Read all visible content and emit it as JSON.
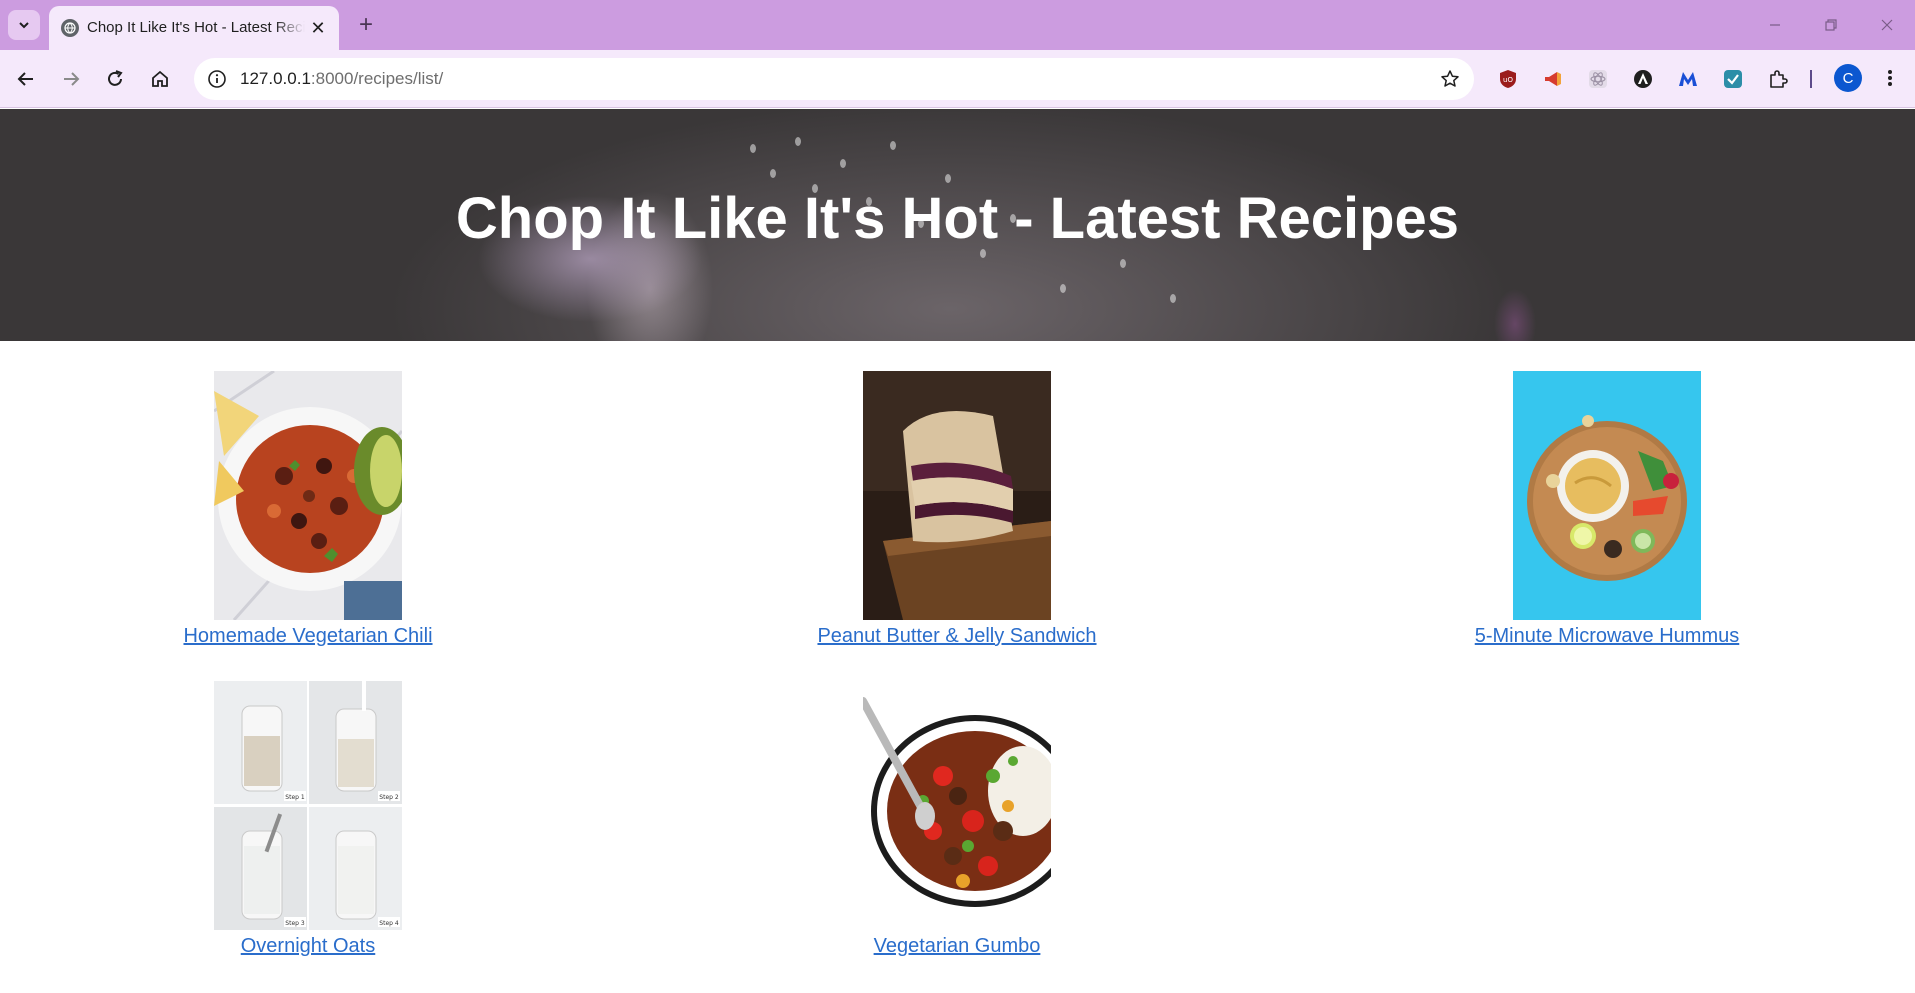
{
  "browser": {
    "tab_title": "Chop It Like It's Hot - Latest Recipes",
    "url_host": "127.0.0.1",
    "url_rest": ":8000/recipes/list/",
    "profile_initial": "C"
  },
  "page": {
    "title": "Chop It Like It's Hot - Latest Recipes",
    "recipes": [
      {
        "name": "Homemade Vegetarian Chili"
      },
      {
        "name": "Peanut Butter & Jelly Sandwich"
      },
      {
        "name": "5-Minute Microwave Hummus"
      },
      {
        "name": "Overnight Oats"
      },
      {
        "name": "Vegetarian Gumbo"
      }
    ],
    "oats_steps": [
      "Step 1",
      "Step 2",
      "Step 3",
      "Step 4"
    ]
  },
  "colors": {
    "tabstrip": "#cc9ce0",
    "toolbar": "#f5e9fb",
    "link": "#2a6dcb"
  }
}
